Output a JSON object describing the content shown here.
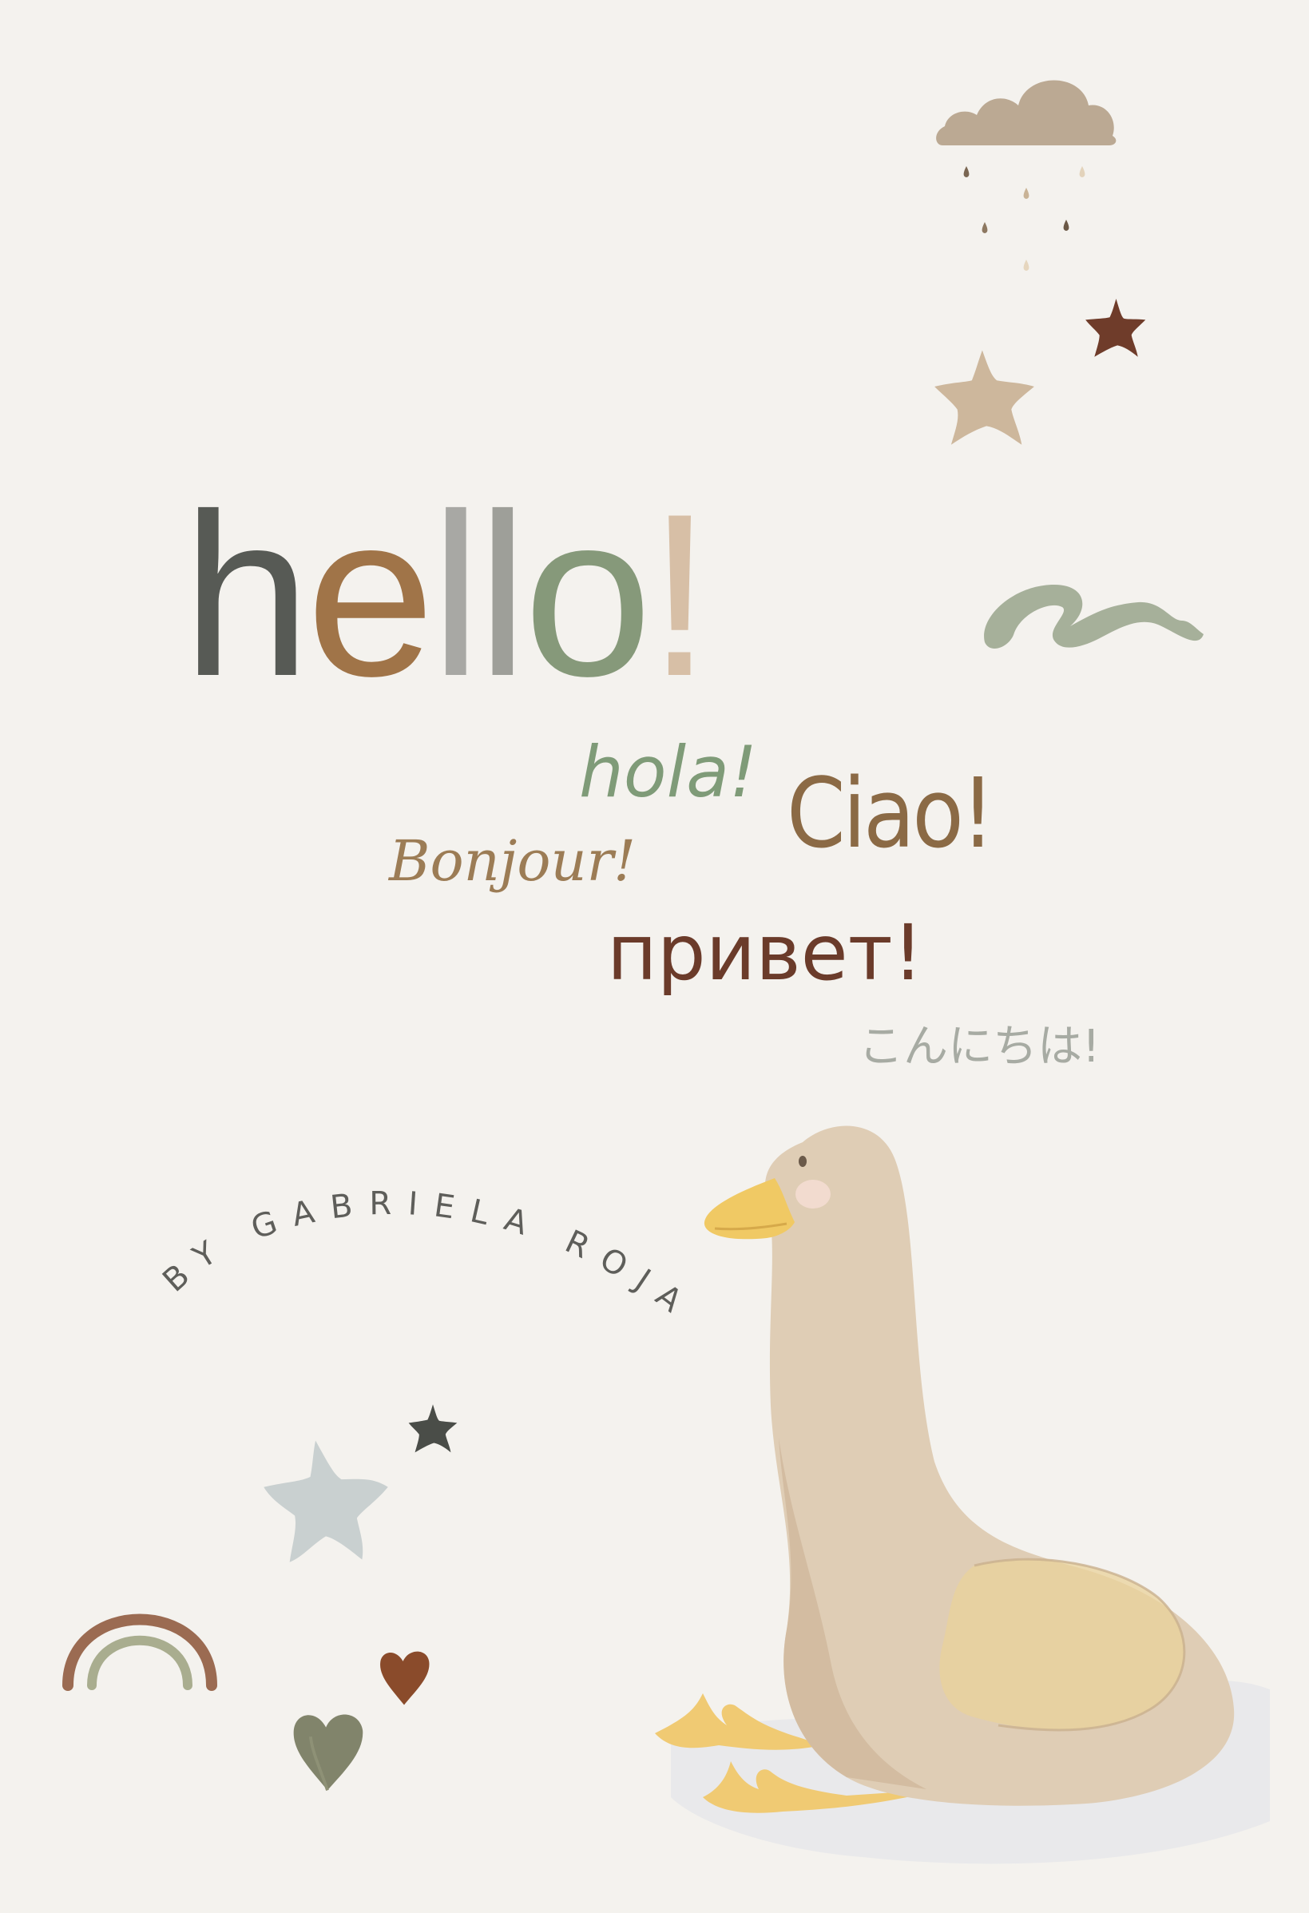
{
  "cover": {
    "title_letters": [
      {
        "char": "h",
        "color": "#575a55"
      },
      {
        "char": "e",
        "color": "#a07448"
      },
      {
        "char": "l",
        "color": "#a8a8a4"
      },
      {
        "char": "l",
        "color": "#9e9f99"
      },
      {
        "char": "o",
        "color": "#86997a"
      },
      {
        "char": "!",
        "color": "#d7bfa6"
      }
    ],
    "greetings": {
      "hola": "hola!",
      "ciao": "Ciao!",
      "bonjour": "Bonjour!",
      "privet": "привет!",
      "konnichiwa": "こんにちは!"
    },
    "author": "BY GABRIELA ROJAS",
    "icons": [
      "cloud-rain-icon",
      "star-icon",
      "squiggle-icon",
      "rainbow-icon",
      "heart-icon",
      "duck-illustration"
    ],
    "colors": {
      "background": "#f4f2ee",
      "cloud": "#bba993",
      "star_dark_brown": "#6f3c2a",
      "star_beige": "#cdb79c",
      "squiggle": "#a6b09a",
      "star_charcoal": "#4a4d48",
      "star_grey_blue": "#c9d0d0",
      "heart_brown": "#8a4b2b",
      "heart_olive": "#7a7d63"
    }
  }
}
